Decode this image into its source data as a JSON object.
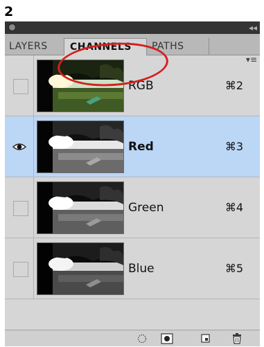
{
  "step_number": "2",
  "tabs": [
    {
      "label": "LAYERS"
    },
    {
      "label": "CHANNELS"
    },
    {
      "label": "PATHS"
    }
  ],
  "channels": [
    {
      "name": "RGB",
      "shortcut": "⌘2"
    },
    {
      "name": "Red",
      "shortcut": "⌘3",
      "visible": true,
      "selected": true
    },
    {
      "name": "Green",
      "shortcut": "⌘4"
    },
    {
      "name": "Blue",
      "shortcut": "⌘5"
    }
  ],
  "colors": {
    "selected_row": "#bcd6f6",
    "highlight": "#d61f1f"
  },
  "footer_icons": [
    "dotted-circle-icon",
    "mask-icon",
    "new-channel-icon",
    "trash-icon"
  ]
}
